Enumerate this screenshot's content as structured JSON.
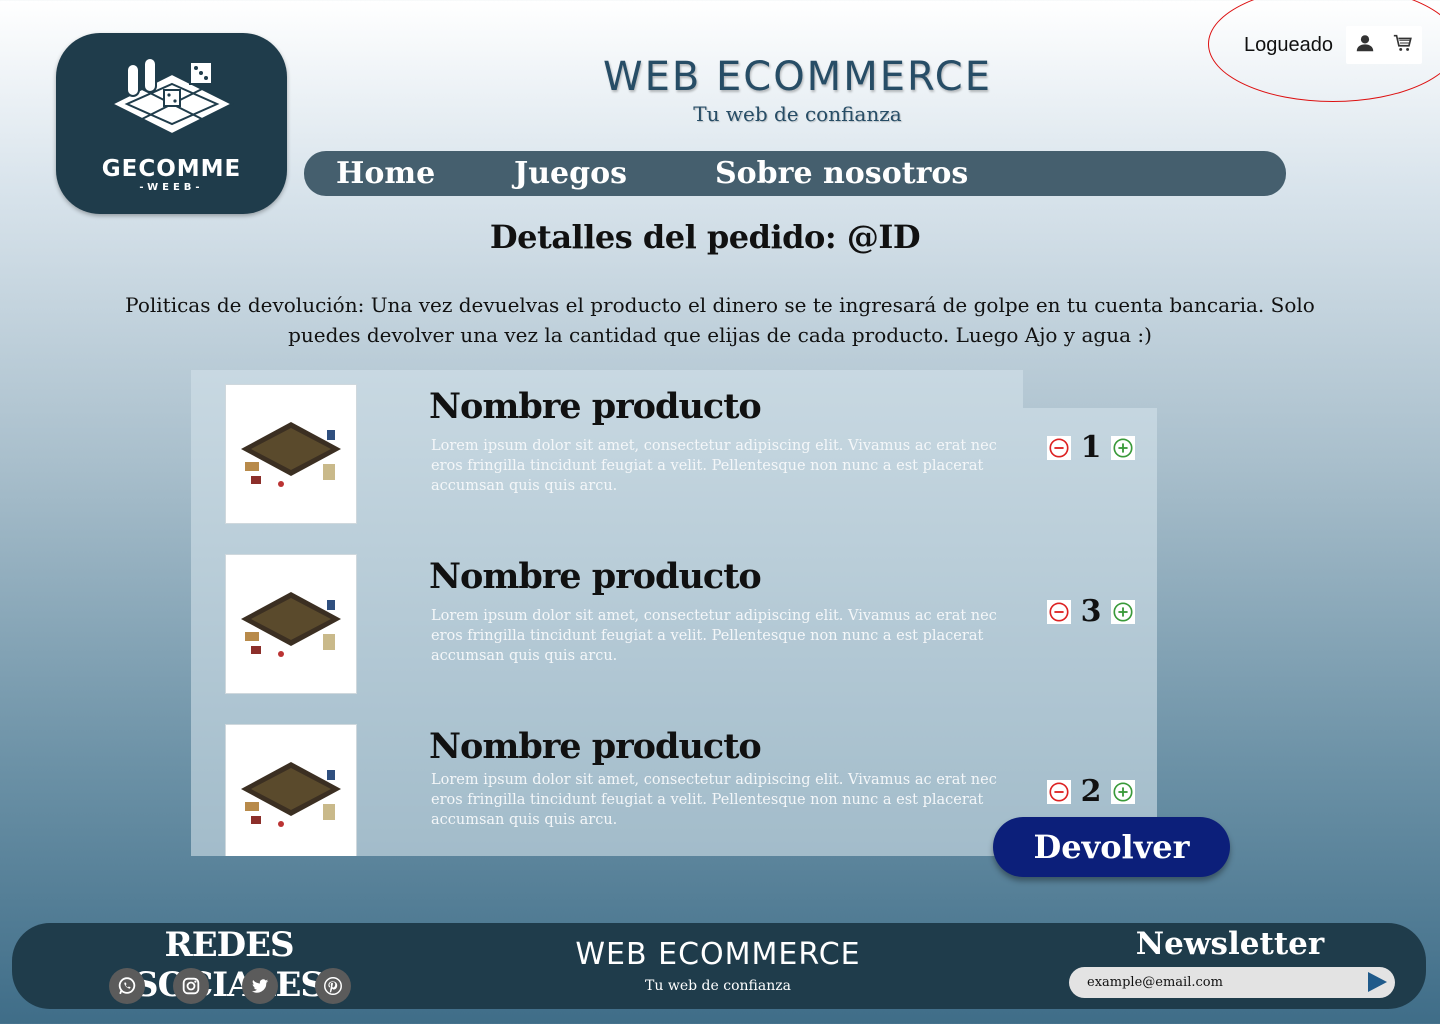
{
  "brand": {
    "logo_name": "GECOMME",
    "logo_sub": "-WEEB-"
  },
  "header": {
    "title": "WEB ECOMMERCE",
    "subtitle": "Tu web de confianza"
  },
  "user": {
    "label": "Logueado",
    "icons": [
      "user-icon",
      "cart-icon"
    ]
  },
  "nav": {
    "items": [
      {
        "label": "Home"
      },
      {
        "label": "Juegos"
      },
      {
        "label": "Sobre nosotros"
      }
    ]
  },
  "page": {
    "title": "Detalles del pedido: @ID",
    "policy_line1": "Politicas de devolución: Una vez devuelvas el producto el dinero se te ingresará de golpe en tu cuenta bancaria. Solo",
    "policy_line2": "puedes devolver una vez la cantidad que elijas de cada producto. Luego Ajo y agua :)"
  },
  "products": [
    {
      "name": "Nombre producto",
      "description": "Lorem ipsum dolor sit amet, consectetur adipiscing elit. Vivamus ac erat nec eros fringilla tincidunt feugiat a velit. Pellentesque non nunc a est placerat accumsan quis quis arcu.",
      "quantity": "1"
    },
    {
      "name": "Nombre producto",
      "description": "Lorem ipsum dolor sit amet, consectetur adipiscing elit. Vivamus ac erat nec eros fringilla tincidunt feugiat a velit. Pellentesque non nunc a est placerat accumsan quis quis arcu.",
      "quantity": "3"
    },
    {
      "name": "Nombre producto",
      "description": "Lorem ipsum dolor sit amet, consectetur adipiscing elit. Vivamus ac erat nec eros fringilla tincidunt feugiat a velit. Pellentesque non nunc a est placerat accumsan quis quis arcu.",
      "quantity": "2"
    }
  ],
  "actions": {
    "return_label": "Devolver"
  },
  "footer": {
    "social_title": "REDES SOCIALES",
    "social_icons": [
      "whatsapp-icon",
      "instagram-icon",
      "twitter-icon",
      "pinterest-icon"
    ],
    "title": "WEB ECOMMERCE",
    "subtitle": "Tu web de confianza",
    "newsletter_title": "Newsletter",
    "newsletter_placeholder": "example@email.com"
  },
  "colors": {
    "nav_bg": "#455f6e",
    "footer_bg": "#1f3c4b",
    "button_bg": "#0c1f7a",
    "minus": "#d22",
    "plus": "#3a9a3a"
  }
}
